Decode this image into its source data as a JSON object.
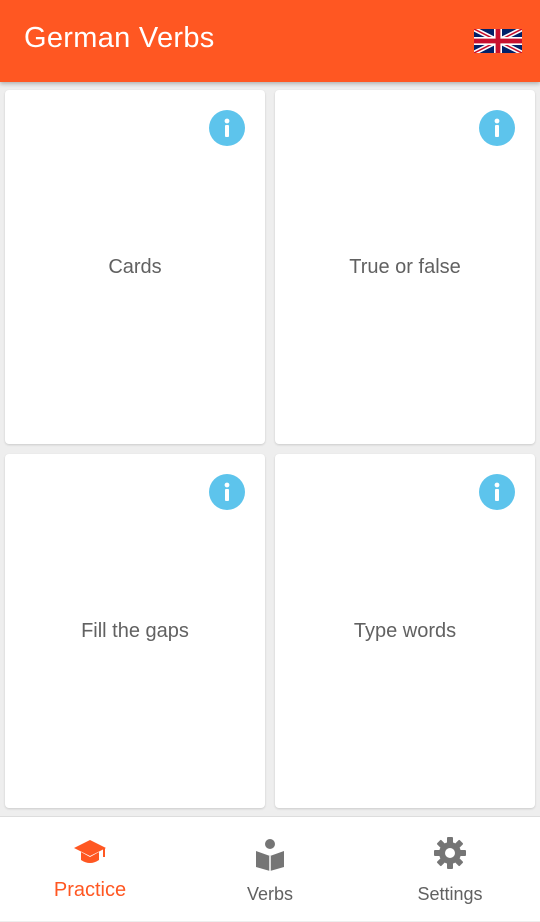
{
  "app_bar": {
    "title": "German Verbs",
    "language_flag_icon": "uk-flag-icon"
  },
  "colors": {
    "primary": "#ff5722",
    "info_badge": "#5dc4ec",
    "text_secondary": "#616161",
    "background": "#eeeeee"
  },
  "modes": [
    {
      "label": "Cards",
      "info_icon": "info-icon"
    },
    {
      "label": "True or false",
      "info_icon": "info-icon"
    },
    {
      "label": "Fill the gaps",
      "info_icon": "info-icon"
    },
    {
      "label": "Type words",
      "info_icon": "info-icon"
    }
  ],
  "bottom_nav": {
    "items": [
      {
        "label": "Practice",
        "icon": "graduation-cap-icon",
        "active": true
      },
      {
        "label": "Verbs",
        "icon": "book-reader-icon",
        "active": false
      },
      {
        "label": "Settings",
        "icon": "gear-icon",
        "active": false
      }
    ]
  }
}
